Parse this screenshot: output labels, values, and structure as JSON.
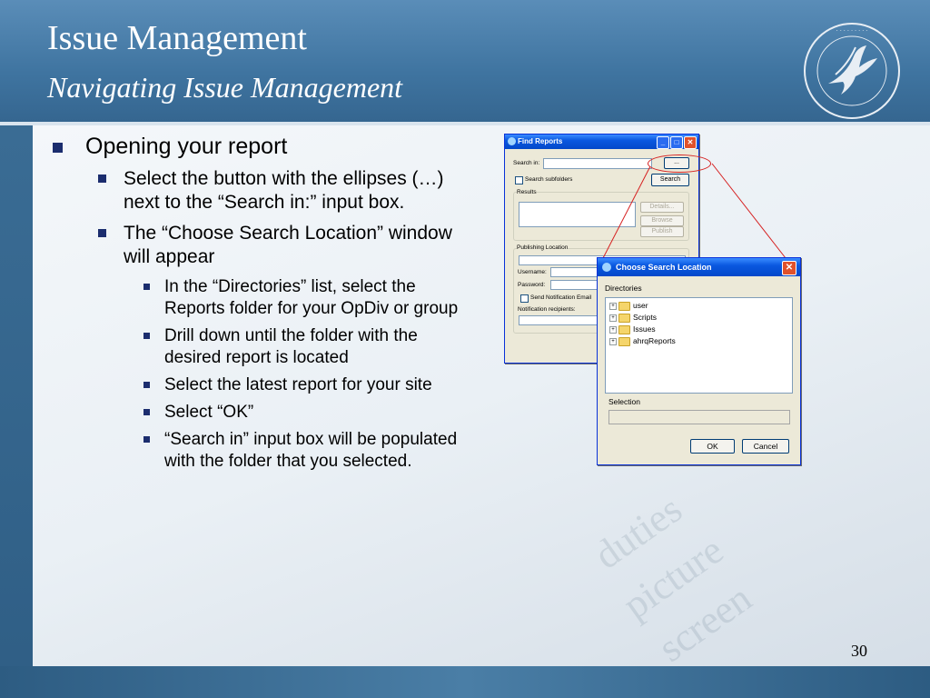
{
  "slide": {
    "title": "Issue Management",
    "subtitle": "Navigating Issue Management",
    "page_number": "30",
    "watermark_words": [
      "duties",
      "picture",
      "screen"
    ]
  },
  "bullets": {
    "l1": "Opening your report",
    "l2a": "Select the button with the ellipses (…) next to the “Search in:” input box.",
    "l2b": "The “Choose Search Location” window will appear",
    "l3": [
      "In the “Directories” list, select the Reports folder for your OpDiv or group",
      "Drill down until the folder with the desired report is located",
      "Select the latest report for your site",
      "Select “OK”",
      "“Search in” input box will be populated with the folder that you selected."
    ]
  },
  "find_reports": {
    "title": "Find Reports",
    "search_in_label": "Search in:",
    "ellipsis_label": "...",
    "subfolders_label": "Search subfolders",
    "search_button": "Search",
    "results_label": "Results",
    "details_button": "Details...",
    "browse_button": "Browse",
    "publish_button": "Publish",
    "publishing_label": "Publishing Location",
    "username_label": "Username:",
    "password_label": "Password:",
    "send_notification_label": "Send Notification Email",
    "notification_recipients_label": "Notification recipients:"
  },
  "choose_location": {
    "title": "Choose Search Location",
    "directories_label": "Directories",
    "folders": [
      "user",
      "Scripts",
      "Issues",
      "ahrqReports"
    ],
    "selection_label": "Selection",
    "ok_button": "OK",
    "cancel_button": "Cancel"
  },
  "colors": {
    "header_blue": "#3f74a0",
    "bullet_navy": "#1b2d6e",
    "highlight_red": "#d62020"
  }
}
